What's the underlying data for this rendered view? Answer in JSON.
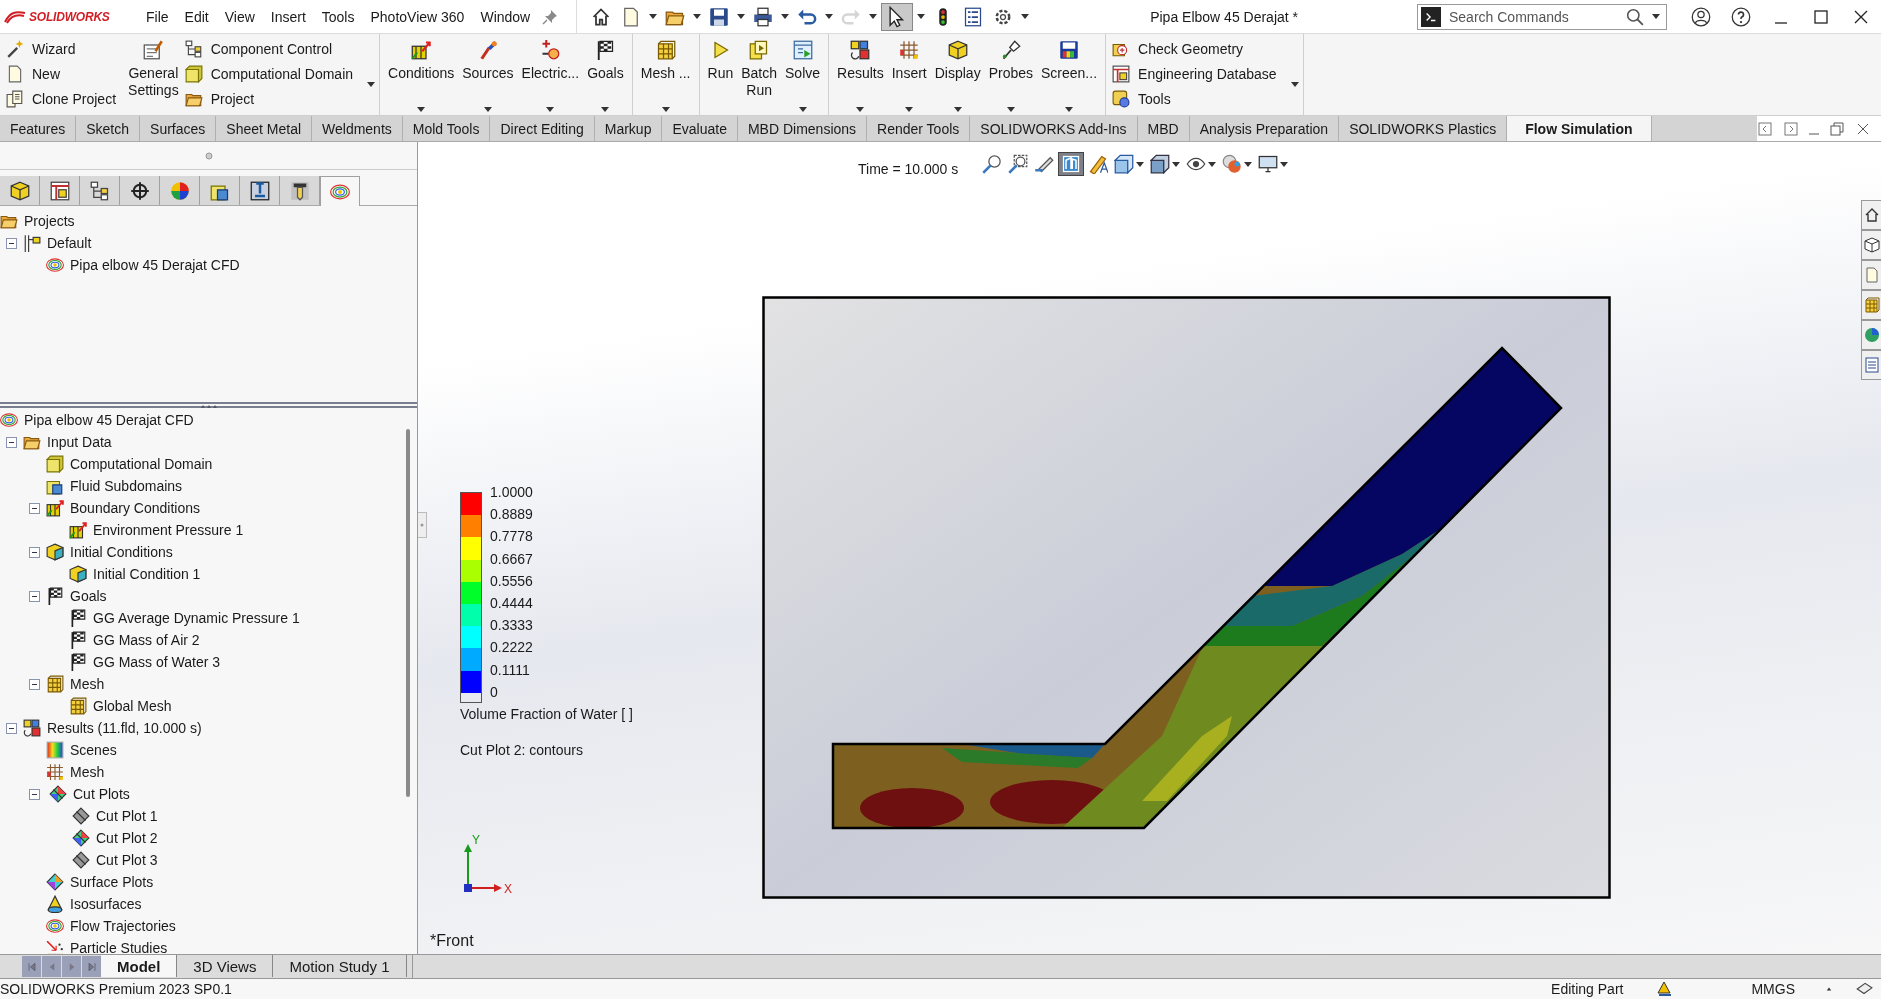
{
  "app": {
    "logo": "SOLIDWORKS"
  },
  "menu": [
    "File",
    "Edit",
    "View",
    "Insert",
    "Tools",
    "PhotoView 360",
    "Window"
  ],
  "quick_access": {
    "redo_disabled": true,
    "select_selected": true
  },
  "document_title": "Pipa Elbow 45 Derajat *",
  "search": {
    "placeholder": "Search Commands"
  },
  "ribbon": {
    "groups": [
      {
        "dropdown": true,
        "items": [
          {
            "kind": "stack",
            "items": [
              {
                "label": "Wizard"
              },
              {
                "label": "New"
              },
              {
                "label": "Clone Project"
              }
            ]
          },
          {
            "kind": "large",
            "label": "General\nSettings",
            "dropdown": false
          },
          {
            "kind": "stack",
            "items": [
              {
                "label": "Component Control"
              },
              {
                "label": "Computational Domain"
              },
              {
                "label": "Project"
              }
            ]
          }
        ]
      },
      {
        "dropdown": false,
        "items": [
          {
            "kind": "large",
            "label": "Conditions",
            "dropdown": true
          },
          {
            "kind": "large",
            "label": "Sources",
            "dropdown": true
          },
          {
            "kind": "large",
            "label": "Electric...",
            "dropdown": true
          },
          {
            "kind": "large",
            "label": "Goals",
            "dropdown": true
          }
        ]
      },
      {
        "dropdown": false,
        "items": [
          {
            "kind": "large",
            "label": "Mesh ...",
            "dropdown": true
          }
        ]
      },
      {
        "dropdown": false,
        "items": [
          {
            "kind": "large",
            "label": "Run",
            "dropdown": false
          },
          {
            "kind": "large",
            "label": "Batch\nRun",
            "dropdown": false
          },
          {
            "kind": "large",
            "label": "Solve",
            "dropdown": true
          }
        ]
      },
      {
        "dropdown": false,
        "items": [
          {
            "kind": "large",
            "label": "Results",
            "dropdown": true
          },
          {
            "kind": "large",
            "label": "Insert",
            "dropdown": true
          },
          {
            "kind": "large",
            "label": "Display",
            "dropdown": true
          },
          {
            "kind": "large",
            "label": "Probes",
            "dropdown": true
          },
          {
            "kind": "large",
            "label": "Screen...",
            "dropdown": true
          }
        ]
      },
      {
        "dropdown": true,
        "items": [
          {
            "kind": "stack",
            "items": [
              {
                "label": "Check Geometry"
              },
              {
                "label": "Engineering Database"
              },
              {
                "label": "Tools"
              }
            ]
          }
        ]
      }
    ]
  },
  "command_tabs": [
    {
      "label": "Features",
      "selected": false
    },
    {
      "label": "Sketch",
      "selected": false
    },
    {
      "label": "Surfaces",
      "selected": false
    },
    {
      "label": "Sheet Metal",
      "selected": false
    },
    {
      "label": "Weldments",
      "selected": false
    },
    {
      "label": "Mold Tools",
      "selected": false
    },
    {
      "label": "Direct Editing",
      "selected": false
    },
    {
      "label": "Markup",
      "selected": false
    },
    {
      "label": "Evaluate",
      "selected": false
    },
    {
      "label": "MBD Dimensions",
      "selected": false
    },
    {
      "label": "Render Tools",
      "selected": false
    },
    {
      "label": "SOLIDWORKS Add-Ins",
      "selected": false
    },
    {
      "label": "MBD",
      "selected": false
    },
    {
      "label": "Analysis Preparation",
      "selected": false
    },
    {
      "label": "SOLIDWORKS Plastics",
      "selected": false
    },
    {
      "label": "Flow Simulation",
      "selected": true
    }
  ],
  "panel_tabs": [
    {
      "selected": false
    },
    {
      "selected": false
    },
    {
      "selected": false
    },
    {
      "selected": false
    },
    {
      "selected": false
    },
    {
      "selected": false
    },
    {
      "selected": false
    },
    {
      "selected": false
    },
    {
      "selected": true
    }
  ],
  "project_tree": [
    {
      "label": "Projects",
      "kind": "folder",
      "children": [
        {
          "label": "Default",
          "kind": "config",
          "expanded": true,
          "children": [
            {
              "label": "Pipa elbow 45 Derajat CFD",
              "kind": "project"
            }
          ]
        }
      ]
    }
  ],
  "analysis_tree": [
    {
      "label": "Pipa elbow 45 Derajat CFD",
      "kind": "project",
      "children": [
        {
          "label": "Input Data",
          "kind": "folder",
          "expanded": true,
          "children": [
            {
              "label": "Computational Domain",
              "kind": "domain"
            },
            {
              "label": "Fluid Subdomains",
              "kind": "subdomain"
            },
            {
              "label": "Boundary Conditions",
              "kind": "boundary",
              "expanded": true,
              "children": [
                {
                  "label": "Environment Pressure 1",
                  "kind": "boundary"
                }
              ]
            },
            {
              "label": "Initial Conditions",
              "kind": "initial",
              "expanded": true,
              "children": [
                {
                  "label": "Initial Condition 1",
                  "kind": "initial"
                }
              ]
            },
            {
              "label": "Goals",
              "kind": "goal",
              "expanded": true,
              "children": [
                {
                  "label": "GG Average Dynamic Pressure 1",
                  "kind": "goal"
                },
                {
                  "label": "GG Mass of Air 2",
                  "kind": "goal"
                },
                {
                  "label": "GG Mass of Water 3",
                  "kind": "goal"
                }
              ]
            },
            {
              "label": "Mesh",
              "kind": "mesh",
              "expanded": true,
              "children": [
                {
                  "label": "Global Mesh",
                  "kind": "mesh"
                }
              ]
            }
          ]
        },
        {
          "label": "Results (11.fld, 10.000 s)",
          "kind": "results",
          "expanded": true,
          "children": [
            {
              "label": "Scenes",
              "kind": "scenes"
            },
            {
              "label": "Mesh",
              "kind": "meshplot"
            },
            {
              "label": "Cut Plots",
              "kind": "cutplot",
              "visible": true,
              "expanded": true,
              "children": [
                {
                  "label": "Cut Plot 1",
                  "kind": "cutplot",
                  "visible": false
                },
                {
                  "label": "Cut Plot 2",
                  "kind": "cutplot",
                  "visible": true
                },
                {
                  "label": "Cut Plot 3",
                  "kind": "cutplot",
                  "visible": false
                }
              ]
            },
            {
              "label": "Surface Plots",
              "kind": "surface"
            },
            {
              "label": "Isosurfaces",
              "kind": "iso"
            },
            {
              "label": "Flow Trajectories",
              "kind": "project"
            },
            {
              "label": "Particle Studies",
              "kind": "particle"
            }
          ]
        }
      ]
    }
  ],
  "viewport": {
    "time": "Time = 10.000 s",
    "section_view_selected": true,
    "legend": {
      "labels": [
        "1.0000",
        "0.8889",
        "0.7778",
        "0.6667",
        "0.5556",
        "0.4444",
        "0.3333",
        "0.2222",
        "0.1111",
        "0"
      ],
      "bands": [
        {
          "color": "#ff0000"
        },
        {
          "color": "#ff7f00"
        },
        {
          "color": "#ffff00"
        },
        {
          "color": "#aaff00"
        },
        {
          "color": "#00ff2a"
        },
        {
          "color": "#00ffaa"
        },
        {
          "color": "#00ffff"
        },
        {
          "color": "#00aaff"
        },
        {
          "color": "#0000ff"
        }
      ],
      "title": "Volume Fraction of Water [ ]"
    },
    "plot_caption": "Cut Plot 2: contours",
    "triad": {
      "y": "Y",
      "x": "X"
    },
    "view_name": "*Front"
  },
  "bottom_tabs": [
    {
      "label": "Model",
      "selected": true
    },
    {
      "label": "3D Views",
      "selected": false
    },
    {
      "label": "Motion Study 1",
      "selected": false
    }
  ],
  "status_bar": {
    "product": "SOLIDWORKS Premium 2023 SP0.1",
    "mode": "Editing Part",
    "units": "MMGS"
  }
}
